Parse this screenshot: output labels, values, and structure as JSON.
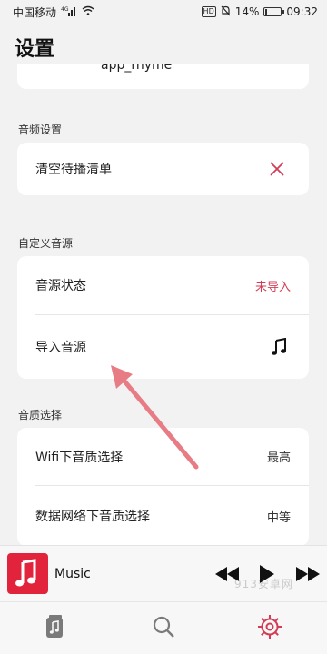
{
  "status_bar": {
    "carrier": "中国移动",
    "network": "4G",
    "battery_percent": "14%",
    "battery_level": 0.14,
    "time": "09:32"
  },
  "header": {
    "title": "设置"
  },
  "top_partial": {
    "value": "app_rhyme"
  },
  "sections": {
    "audio_settings": {
      "label": "音频设置",
      "clear_queue_label": "清空待播清单"
    },
    "custom_source": {
      "label": "自定义音源",
      "status_label": "音源状态",
      "status_value": "未导入",
      "import_label": "导入音源"
    },
    "quality": {
      "label": "音质选择",
      "wifi_label": "Wifi下音质选择",
      "wifi_value": "最高",
      "cellular_label": "数据网络下音质选择",
      "cellular_value": "中等"
    }
  },
  "mini_player": {
    "title": "Music"
  },
  "watermark": "913安卓网",
  "colors": {
    "accent": "#d23d55",
    "album": "#e1243b",
    "arrow": "#e87c85"
  },
  "icons": {
    "clear": "close-icon",
    "import": "music-note-icon",
    "prev": "rewind-icon",
    "play": "play-icon",
    "next": "fast-forward-icon",
    "tab_library": "library-icon",
    "tab_search": "search-icon",
    "tab_settings": "gear-icon"
  }
}
